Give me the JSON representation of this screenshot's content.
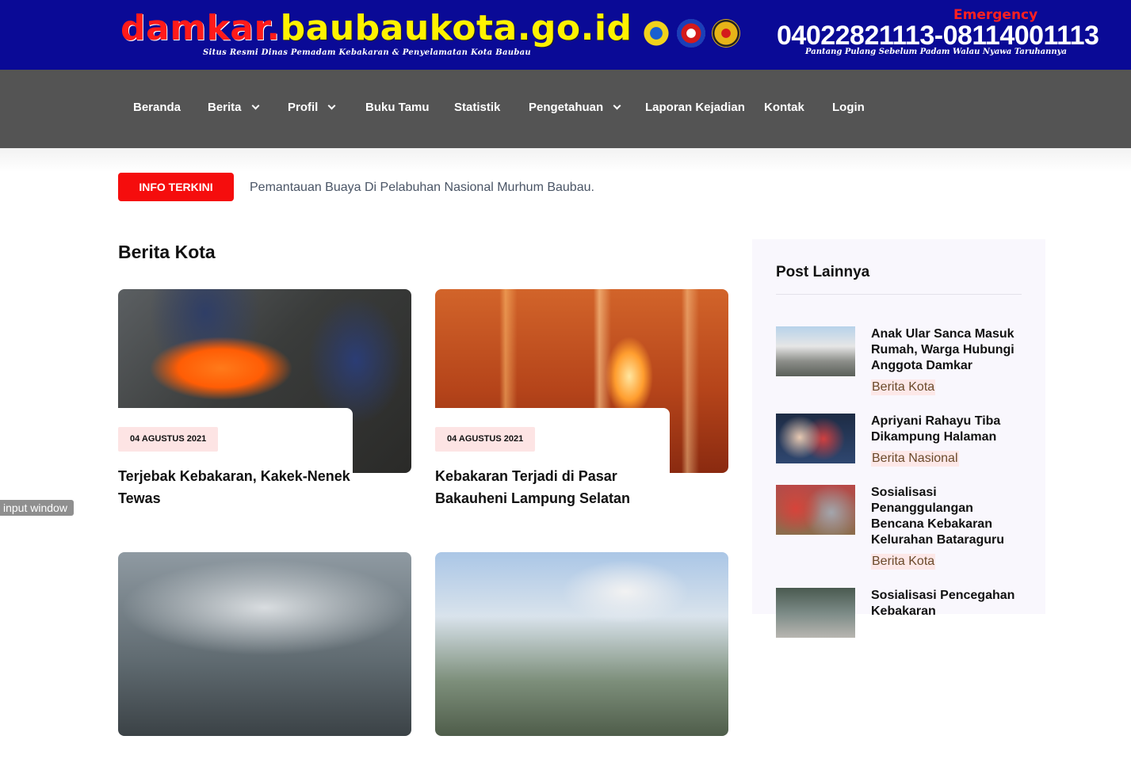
{
  "header": {
    "brand_red": "damkar.",
    "brand_yellow": "baubaukota.go.id",
    "subtitle": "Situs Resmi Dinas Pemadam Kebakaran & Penyelamatan Kota Baubau",
    "emergency_label": "Emergency",
    "phone": "04022821113-08114001113",
    "motto": "Pantang Pulang Sebelum Padam Walau Nyawa Taruhannya",
    "logos": [
      "city-emblem-logo",
      "fire-department-logo",
      "regional-emblem-logo"
    ],
    "background_color": "#0a0a96"
  },
  "nav": {
    "items": [
      {
        "label": "Beranda",
        "dropdown": false
      },
      {
        "label": "Berita",
        "dropdown": true
      },
      {
        "label": "Profil",
        "dropdown": true
      },
      {
        "label": "Buku Tamu",
        "dropdown": false
      },
      {
        "label": "Statistik",
        "dropdown": false
      },
      {
        "label": "Pengetahuan",
        "dropdown": true
      },
      {
        "label": "Laporan Kejadian",
        "dropdown": false
      },
      {
        "label": "Kontak",
        "dropdown": false
      },
      {
        "label": "Login",
        "dropdown": false
      }
    ],
    "background_color": "#545454"
  },
  "ticker": {
    "badge": "INFO TERKINI",
    "text": "Pemantauan Buaya Di Pelabuhan Nasional Murhum Baubau.",
    "badge_color": "#f50d0d"
  },
  "main": {
    "section_title": "Berita Kota",
    "cards": [
      {
        "date": "04 AGUSTUS 2021",
        "title": "Terjebak Kebakaran, Kakek-Nenek Tewas"
      },
      {
        "date": "04 AGUSTUS 2021",
        "title": "Kebakaran Terjadi di Pasar Bakauheni Lampung Selatan"
      },
      {
        "date": "",
        "title": ""
      },
      {
        "date": "",
        "title": ""
      }
    ]
  },
  "sidebar": {
    "title": "Post Lainnya",
    "posts": [
      {
        "title": "Anak Ular Sanca Masuk Rumah, Warga Hubungi Anggota Damkar",
        "category": "Berita Kota"
      },
      {
        "title": "Apriyani Rahayu Tiba Dikampung Halaman",
        "category": "Berita Nasional"
      },
      {
        "title": "Sosialisasi Penanggulangan Bencana Kebakaran Kelurahan Bataraguru",
        "category": "Berita Kota"
      },
      {
        "title": "Sosialisasi Pencegahan Kebakaran",
        "category": ""
      }
    ]
  },
  "overlay": {
    "input_window_label": "input window"
  }
}
